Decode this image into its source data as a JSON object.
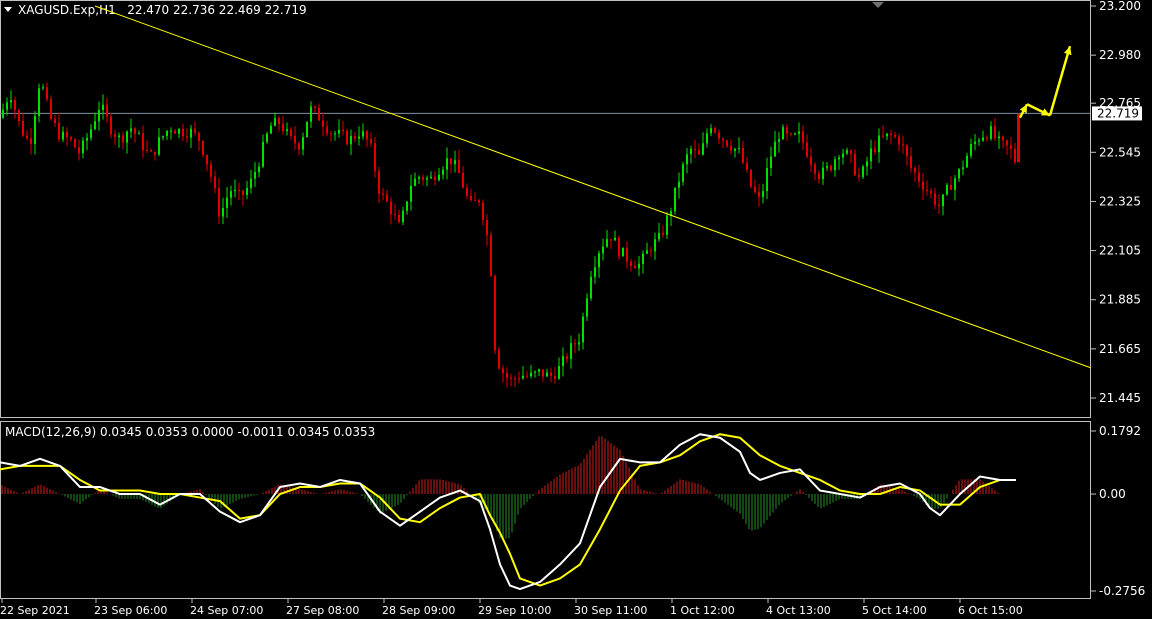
{
  "chart": {
    "symbol_label": "XAGUSD.Exp,H1",
    "ohlc_label": "22.470 22.736 22.469 22.719",
    "macd_label": "MACD(12,26,9) 0.0345 0.0353 0.0000 -0.0011 0.0345 0.0353",
    "current_price_label": "22.719"
  },
  "colors": {
    "background": "#000000",
    "bull_candle": "#00e000",
    "bear_candle": "#e00000",
    "trendline": "#ffff00",
    "arrows": "#ffff00",
    "macd_line": "#ffffff",
    "signal_line": "#ffff00",
    "hist_positive": "#b01818",
    "hist_negative": "#1e7a1e"
  },
  "chart_data": [
    {
      "type": "candlestick",
      "title": "XAGUSD.Exp,H1",
      "y_ticks": [
        "23.200",
        "22.980",
        "22.765",
        "22.545",
        "22.325",
        "22.105",
        "21.885",
        "21.665",
        "21.445"
      ],
      "x_ticks": [
        "22 Sep 2021",
        "23 Sep 06:00",
        "24 Sep 07:00",
        "27 Sep 08:00",
        "28 Sep 09:00",
        "29 Sep 10:00",
        "30 Sep 11:00",
        "1 Oct 12:00",
        "4 Oct 13:00",
        "5 Oct 14:00",
        "6 Oct 15:00"
      ],
      "ylim": [
        21.41,
        23.22
      ],
      "current_price": 22.719,
      "close_path": [
        [
          0,
          22.7
        ],
        [
          10,
          22.82
        ],
        [
          20,
          22.66
        ],
        [
          30,
          22.58
        ],
        [
          40,
          22.88
        ],
        [
          50,
          22.7
        ],
        [
          60,
          22.62
        ],
        [
          70,
          22.6
        ],
        [
          80,
          22.54
        ],
        [
          90,
          22.64
        ],
        [
          100,
          22.76
        ],
        [
          110,
          22.66
        ],
        [
          120,
          22.6
        ],
        [
          130,
          22.66
        ],
        [
          140,
          22.6
        ],
        [
          150,
          22.52
        ],
        [
          160,
          22.6
        ],
        [
          170,
          22.66
        ],
        [
          180,
          22.64
        ],
        [
          190,
          22.64
        ],
        [
          200,
          22.6
        ],
        [
          210,
          22.46
        ],
        [
          220,
          22.26
        ],
        [
          230,
          22.38
        ],
        [
          240,
          22.34
        ],
        [
          250,
          22.4
        ],
        [
          260,
          22.52
        ],
        [
          270,
          22.66
        ],
        [
          280,
          22.68
        ],
        [
          290,
          22.6
        ],
        [
          300,
          22.58
        ],
        [
          310,
          22.74
        ],
        [
          320,
          22.7
        ],
        [
          330,
          22.64
        ],
        [
          340,
          22.62
        ],
        [
          350,
          22.6
        ],
        [
          360,
          22.64
        ],
        [
          370,
          22.58
        ],
        [
          380,
          22.36
        ],
        [
          390,
          22.3
        ],
        [
          400,
          22.2
        ],
        [
          410,
          22.4
        ],
        [
          420,
          22.44
        ],
        [
          430,
          22.42
        ],
        [
          440,
          22.48
        ],
        [
          450,
          22.52
        ],
        [
          460,
          22.44
        ],
        [
          470,
          22.3
        ],
        [
          480,
          22.34
        ],
        [
          490,
          22.1
        ],
        [
          495,
          21.68
        ],
        [
          500,
          21.58
        ],
        [
          510,
          21.52
        ],
        [
          520,
          21.55
        ],
        [
          530,
          21.54
        ],
        [
          540,
          21.56
        ],
        [
          550,
          21.54
        ],
        [
          560,
          21.58
        ],
        [
          570,
          21.66
        ],
        [
          580,
          21.72
        ],
        [
          590,
          22.0
        ],
        [
          600,
          22.12
        ],
        [
          610,
          22.18
        ],
        [
          620,
          22.1
        ],
        [
          630,
          22.06
        ],
        [
          640,
          22.04
        ],
        [
          650,
          22.12
        ],
        [
          660,
          22.16
        ],
        [
          670,
          22.28
        ],
        [
          680,
          22.44
        ],
        [
          690,
          22.56
        ],
        [
          700,
          22.52
        ],
        [
          710,
          22.68
        ],
        [
          720,
          22.62
        ],
        [
          730,
          22.58
        ],
        [
          740,
          22.54
        ],
        [
          750,
          22.4
        ],
        [
          760,
          22.32
        ],
        [
          770,
          22.52
        ],
        [
          780,
          22.64
        ],
        [
          790,
          22.6
        ],
        [
          800,
          22.62
        ],
        [
          810,
          22.52
        ],
        [
          820,
          22.44
        ],
        [
          830,
          22.48
        ],
        [
          840,
          22.56
        ],
        [
          850,
          22.52
        ],
        [
          860,
          22.42
        ],
        [
          870,
          22.54
        ],
        [
          880,
          22.6
        ],
        [
          890,
          22.62
        ],
        [
          900,
          22.6
        ],
        [
          910,
          22.48
        ],
        [
          920,
          22.42
        ],
        [
          930,
          22.36
        ],
        [
          940,
          22.3
        ],
        [
          950,
          22.4
        ],
        [
          960,
          22.46
        ],
        [
          970,
          22.56
        ],
        [
          980,
          22.62
        ],
        [
          990,
          22.64
        ],
        [
          1000,
          22.58
        ],
        [
          1010,
          22.56
        ],
        [
          1016,
          22.5
        ],
        [
          1020,
          22.719
        ]
      ],
      "trendline": [
        [
          95,
          23.2
        ],
        [
          1091,
          21.58
        ]
      ],
      "forecast_arrows": [
        [
          1020,
          22.7
        ],
        [
          1027,
          22.76
        ],
        [
          1050,
          22.71
        ],
        [
          1070,
          23.02
        ]
      ]
    },
    {
      "type": "line",
      "title": "MACD(12,26,9)",
      "y_ticks": [
        "0.1792",
        "0.00",
        "-0.2756"
      ],
      "ylim": [
        -0.28,
        0.19
      ],
      "series": [
        {
          "name": "MACD",
          "points": [
            [
              0,
              0.09
            ],
            [
              20,
              0.08
            ],
            [
              40,
              0.1
            ],
            [
              60,
              0.08
            ],
            [
              80,
              0.02
            ],
            [
              100,
              0.02
            ],
            [
              120,
              0.0
            ],
            [
              140,
              0.0
            ],
            [
              160,
              -0.03
            ],
            [
              180,
              0.0
            ],
            [
              200,
              0.0
            ],
            [
              220,
              -0.05
            ],
            [
              240,
              -0.08
            ],
            [
              260,
              -0.06
            ],
            [
              280,
              0.02
            ],
            [
              300,
              0.03
            ],
            [
              320,
              0.02
            ],
            [
              340,
              0.04
            ],
            [
              360,
              0.03
            ],
            [
              380,
              -0.05
            ],
            [
              400,
              -0.09
            ],
            [
              420,
              -0.05
            ],
            [
              440,
              -0.01
            ],
            [
              460,
              0.01
            ],
            [
              480,
              -0.02
            ],
            [
              490,
              -0.1
            ],
            [
              500,
              -0.2
            ],
            [
              510,
              -0.26
            ],
            [
              520,
              -0.27
            ],
            [
              540,
              -0.25
            ],
            [
              560,
              -0.2
            ],
            [
              580,
              -0.14
            ],
            [
              600,
              0.02
            ],
            [
              620,
              0.1
            ],
            [
              640,
              0.09
            ],
            [
              660,
              0.09
            ],
            [
              680,
              0.14
            ],
            [
              700,
              0.17
            ],
            [
              720,
              0.16
            ],
            [
              740,
              0.12
            ],
            [
              750,
              0.06
            ],
            [
              760,
              0.04
            ],
            [
              780,
              0.06
            ],
            [
              800,
              0.07
            ],
            [
              820,
              0.01
            ],
            [
              840,
              0.0
            ],
            [
              860,
              -0.01
            ],
            [
              880,
              0.02
            ],
            [
              900,
              0.03
            ],
            [
              920,
              0.0
            ],
            [
              930,
              -0.04
            ],
            [
              940,
              -0.06
            ],
            [
              960,
              0.0
            ],
            [
              980,
              0.05
            ],
            [
              1000,
              0.04
            ],
            [
              1016,
              0.04
            ]
          ]
        },
        {
          "name": "Signal",
          "points": [
            [
              0,
              0.07
            ],
            [
              20,
              0.08
            ],
            [
              40,
              0.08
            ],
            [
              60,
              0.08
            ],
            [
              80,
              0.04
            ],
            [
              100,
              0.01
            ],
            [
              120,
              0.01
            ],
            [
              140,
              0.01
            ],
            [
              160,
              0.0
            ],
            [
              180,
              0.0
            ],
            [
              200,
              -0.01
            ],
            [
              220,
              -0.02
            ],
            [
              240,
              -0.07
            ],
            [
              260,
              -0.06
            ],
            [
              280,
              0.0
            ],
            [
              300,
              0.02
            ],
            [
              320,
              0.02
            ],
            [
              340,
              0.03
            ],
            [
              360,
              0.03
            ],
            [
              380,
              -0.01
            ],
            [
              400,
              -0.07
            ],
            [
              420,
              -0.08
            ],
            [
              440,
              -0.04
            ],
            [
              460,
              -0.01
            ],
            [
              480,
              0.0
            ],
            [
              490,
              -0.06
            ],
            [
              500,
              -0.11
            ],
            [
              510,
              -0.17
            ],
            [
              520,
              -0.24
            ],
            [
              540,
              -0.26
            ],
            [
              560,
              -0.24
            ],
            [
              580,
              -0.2
            ],
            [
              600,
              -0.1
            ],
            [
              620,
              0.01
            ],
            [
              640,
              0.08
            ],
            [
              660,
              0.09
            ],
            [
              680,
              0.11
            ],
            [
              700,
              0.15
            ],
            [
              720,
              0.17
            ],
            [
              740,
              0.16
            ],
            [
              760,
              0.11
            ],
            [
              780,
              0.08
            ],
            [
              800,
              0.06
            ],
            [
              820,
              0.04
            ],
            [
              840,
              0.01
            ],
            [
              860,
              0.0
            ],
            [
              880,
              0.0
            ],
            [
              900,
              0.02
            ],
            [
              920,
              0.01
            ],
            [
              940,
              -0.03
            ],
            [
              960,
              -0.03
            ],
            [
              980,
              0.02
            ],
            [
              1000,
              0.04
            ],
            [
              1016,
              0.04
            ]
          ]
        }
      ]
    }
  ]
}
